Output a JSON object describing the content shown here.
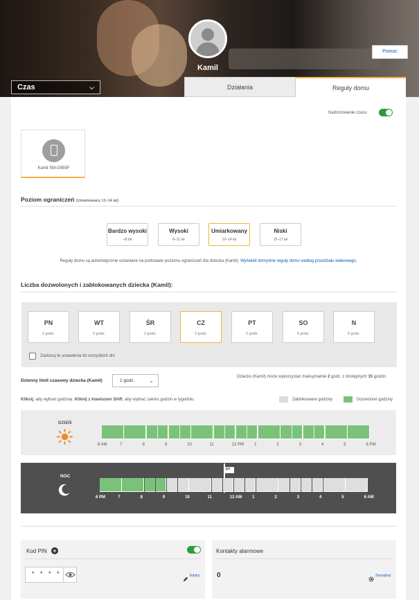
{
  "header": {
    "child_name": "Kamil",
    "help_label": "Pomoc",
    "section_select": "Czas",
    "tabs": [
      {
        "label": "Działania"
      },
      {
        "label": "Reguły domu"
      }
    ]
  },
  "monitoring": {
    "label": "Nadzorowanie czasu",
    "enabled": true
  },
  "device": {
    "label": "Kamil SM-G955F"
  },
  "restriction": {
    "title": "Poziom ograniczeń",
    "subtitle": "(Umiarkowany 12–14 lat)",
    "levels": [
      {
        "title": "Bardzo wysoki",
        "sub": "<8 lat"
      },
      {
        "title": "Wysoki",
        "sub": "8–11 lat"
      },
      {
        "title": "Umiarkowany",
        "sub": "12–14 lat"
      },
      {
        "title": "Niski",
        "sub": "15–17 lat"
      }
    ],
    "selected_index": 2,
    "info": "Reguły domu są automatycznie ustawiane na podstawie poziomu ograniczeń dla dziecka (Kamil).",
    "info_link": "Wyświetl domyślne reguły domu według przedziału wiekowego."
  },
  "allowed": {
    "title": "Liczba dozwolonych i zablokowanych dziecka (Kamil):",
    "days": [
      {
        "label": "PN",
        "hours": "2 godz."
      },
      {
        "label": "WT",
        "hours": "2 godz."
      },
      {
        "label": "ŚR",
        "hours": "2 godz."
      },
      {
        "label": "CZ",
        "hours": "2 godz."
      },
      {
        "label": "PT",
        "hours": "2 godz."
      },
      {
        "label": "SO",
        "hours": "5 godz."
      },
      {
        "label": "N",
        "hours": "5 godz."
      }
    ],
    "selected_day": 3,
    "apply_all_label": "Zastosuj te ustawienia do wszystkich dni"
  },
  "daily_limit": {
    "label": "Dzienny limit czasowy dziecka (Kamil)",
    "value": "2 godz.",
    "note_prefix": "Dziecko (Kamil) może wykorzystać maksymalnie",
    "note_value": "2",
    "note_mid": "godz. z dostępnych",
    "note_total": "15",
    "note_suffix": "godzin"
  },
  "instructions": {
    "b1": "Kliknij",
    "t1": ", aby wybrać godzinę.",
    "b2": "Kliknij z klawiszem Shift",
    "t2": ", aby wybrać zakres godzin w tygodniu."
  },
  "legend": {
    "blocked": "Zablokowane godziny",
    "allowed": "Dozwolone godziny",
    "blocked_color": "#dcdcdc",
    "allowed_color": "#7ac27a"
  },
  "day_schedule": {
    "label": "DZIEŃ",
    "hour_labels": [
      "6",
      "7",
      "8",
      "9",
      "10",
      "11",
      "12",
      "1",
      "2",
      "3",
      "4",
      "5",
      "6"
    ],
    "hour_suffixes": {
      "0": "AM",
      "6": "PM",
      "12": "PM"
    },
    "allowed_slots": [
      1,
      1,
      1,
      1,
      1,
      1,
      1,
      1,
      1,
      1,
      1,
      1,
      1,
      1,
      1,
      1,
      1,
      1,
      1,
      1,
      1,
      1,
      1,
      1
    ]
  },
  "night_schedule": {
    "label": "NOC",
    "marker": "PT",
    "hour_labels": [
      "6",
      "7",
      "8",
      "9",
      "10",
      "11",
      "12",
      "1",
      "2",
      "3",
      "4",
      "5",
      "6"
    ],
    "hour_suffixes": {
      "0": "PM",
      "6": "AM",
      "12": "AM"
    },
    "allowed_slots": [
      1,
      1,
      1,
      1,
      1,
      1,
      0,
      0,
      0,
      0,
      0,
      0,
      0,
      0,
      0,
      0,
      0,
      0,
      0,
      0,
      0,
      0,
      0,
      0
    ]
  },
  "pin": {
    "title": "Kod PIN",
    "value": "* * * *",
    "edit_label": "Edytuj",
    "enabled": true
  },
  "emergency": {
    "title": "Kontakty alarmowe",
    "count": "0",
    "manage_label": "Zarządzaj"
  },
  "colors": {
    "accent": "#f2b33d",
    "toggle_on": "#2e9b3f",
    "link": "#0a5ab0",
    "night_bg": "#4f4f4f"
  }
}
